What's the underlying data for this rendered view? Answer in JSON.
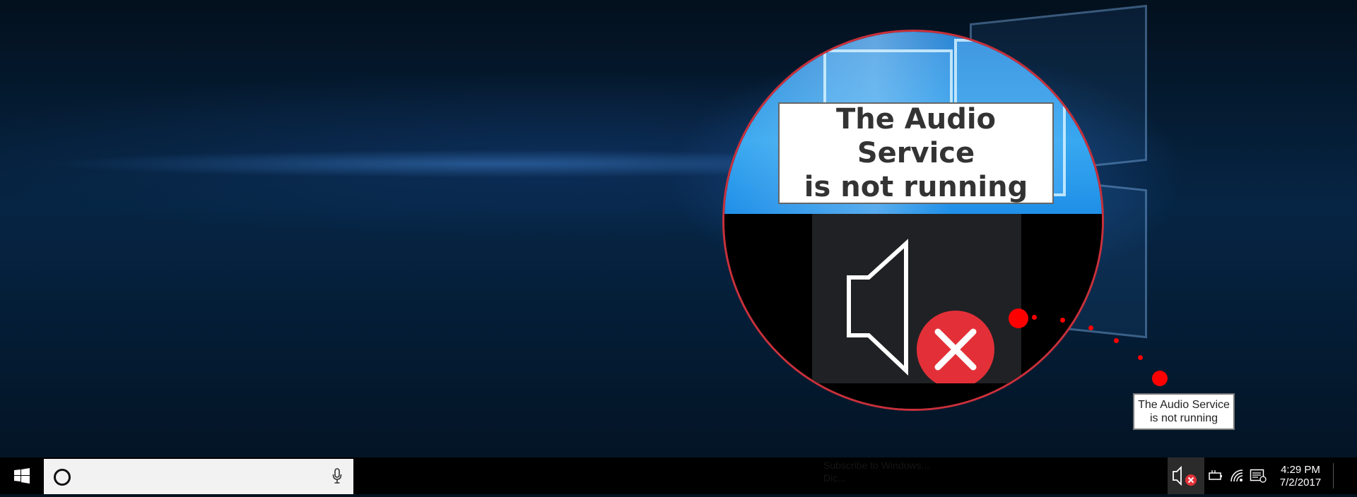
{
  "zoom_label": {
    "line1": "The Audio Service",
    "line2": "is not running"
  },
  "tooltip": {
    "line1": "The Audio Service",
    "line2": "is not running"
  },
  "taskbar": {
    "search_placeholder": "",
    "ghost_text_line1": "Subscribe to Windows...",
    "ghost_text_line2": "Dic..."
  },
  "clock": {
    "time": "4:29 PM",
    "date": "7/2/2017"
  },
  "icons": {
    "start": "windows-logo-icon",
    "cortana": "cortana-icon",
    "mic": "microphone-icon",
    "volume": "volume-muted-error-icon",
    "battery": "battery-icon",
    "wifi": "wifi-icon",
    "action_center": "action-center-icon"
  },
  "colors": {
    "error_red": "#e33038",
    "circle_border": "#c9303b",
    "pointer_dots": "#ff0000",
    "taskbar": "#000000"
  }
}
